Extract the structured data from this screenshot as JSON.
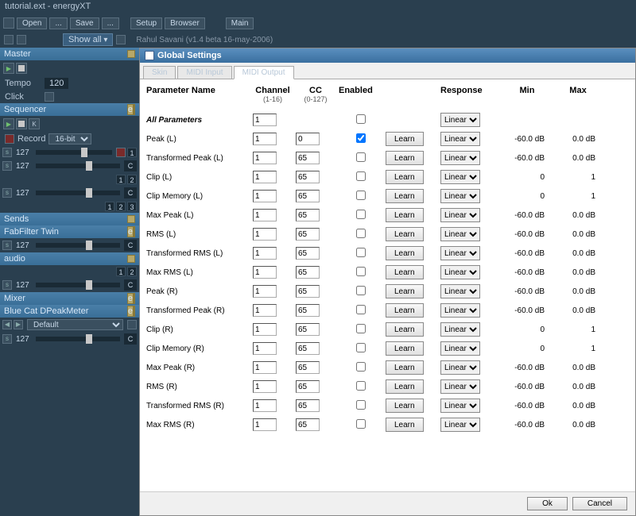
{
  "title": "tutorial.ext - energyXT",
  "toolbar": {
    "open": "Open",
    "save": "Save",
    "setup": "Setup",
    "browser": "Browser",
    "main": "Main",
    "show_all": "Show all",
    "credit": "Rahul Savani (v1.4 beta 16-may-2006)"
  },
  "sidebar": {
    "master": {
      "title": "Master",
      "tempo_label": "Tempo",
      "tempo_val": "120",
      "click_label": "Click"
    },
    "sequencer": {
      "title": "Sequencer",
      "record_label": "Record",
      "bitdepth": "16-bit"
    },
    "sends": {
      "title": "Sends"
    },
    "fabfilter": {
      "title": "FabFilter Twin"
    },
    "audio": {
      "title": "audio"
    },
    "mixer": {
      "title": "Mixer"
    },
    "bluecat": {
      "title": "Blue Cat DPeakMeter"
    },
    "default": {
      "title": "Default"
    },
    "val127": "127",
    "c_label": "C",
    "n1": "1",
    "n2": "2",
    "n3": "3"
  },
  "toolbar_icons": {
    "dots": "...",
    "k": "K"
  },
  "dialog": {
    "title": "Global Settings",
    "tabs": {
      "skin": "Skin",
      "midi_in": "MIDI Input",
      "midi_out": "MIDI Output"
    },
    "headers": {
      "param": "Parameter Name",
      "channel": "Channel",
      "channel_sub": "(1-16)",
      "cc": "CC",
      "cc_sub": "(0-127)",
      "enabled": "Enabled",
      "response": "Response",
      "min": "Min",
      "max": "Max"
    },
    "learn_label": "Learn",
    "linear_label": "Linear",
    "ok": "Ok",
    "cancel": "Cancel",
    "rows": [
      {
        "name": "All Parameters",
        "italic": true,
        "ch": "1",
        "cc": "",
        "en": false,
        "learn": false,
        "min": "",
        "max": ""
      },
      {
        "name": "Peak (L)",
        "ch": "1",
        "cc": "0",
        "en": true,
        "min": "-60.0 dB",
        "max": "0.0 dB"
      },
      {
        "name": "Transformed Peak (L)",
        "ch": "1",
        "cc": "65",
        "en": false,
        "min": "-60.0 dB",
        "max": "0.0 dB"
      },
      {
        "name": "Clip (L)",
        "ch": "1",
        "cc": "65",
        "en": false,
        "min": "0",
        "max": "1"
      },
      {
        "name": "Clip Memory (L)",
        "ch": "1",
        "cc": "65",
        "en": false,
        "min": "0",
        "max": "1"
      },
      {
        "name": "Max Peak (L)",
        "ch": "1",
        "cc": "65",
        "en": false,
        "min": "-60.0 dB",
        "max": "0.0 dB"
      },
      {
        "name": "RMS (L)",
        "ch": "1",
        "cc": "65",
        "en": false,
        "min": "-60.0 dB",
        "max": "0.0 dB"
      },
      {
        "name": "Transformed RMS (L)",
        "ch": "1",
        "cc": "65",
        "en": false,
        "min": "-60.0 dB",
        "max": "0.0 dB"
      },
      {
        "name": "Max RMS (L)",
        "ch": "1",
        "cc": "65",
        "en": false,
        "min": "-60.0 dB",
        "max": "0.0 dB"
      },
      {
        "name": "Peak (R)",
        "ch": "1",
        "cc": "65",
        "en": false,
        "min": "-60.0 dB",
        "max": "0.0 dB"
      },
      {
        "name": "Transformed Peak (R)",
        "ch": "1",
        "cc": "65",
        "en": false,
        "min": "-60.0 dB",
        "max": "0.0 dB"
      },
      {
        "name": "Clip (R)",
        "ch": "1",
        "cc": "65",
        "en": false,
        "min": "0",
        "max": "1"
      },
      {
        "name": "Clip Memory (R)",
        "ch": "1",
        "cc": "65",
        "en": false,
        "min": "0",
        "max": "1"
      },
      {
        "name": "Max Peak (R)",
        "ch": "1",
        "cc": "65",
        "en": false,
        "min": "-60.0 dB",
        "max": "0.0 dB"
      },
      {
        "name": "RMS (R)",
        "ch": "1",
        "cc": "65",
        "en": false,
        "min": "-60.0 dB",
        "max": "0.0 dB"
      },
      {
        "name": "Transformed RMS (R)",
        "ch": "1",
        "cc": "65",
        "en": false,
        "min": "-60.0 dB",
        "max": "0.0 dB"
      },
      {
        "name": "Max RMS (R)",
        "ch": "1",
        "cc": "65",
        "en": false,
        "min": "-60.0 dB",
        "max": "0.0 dB"
      }
    ]
  }
}
